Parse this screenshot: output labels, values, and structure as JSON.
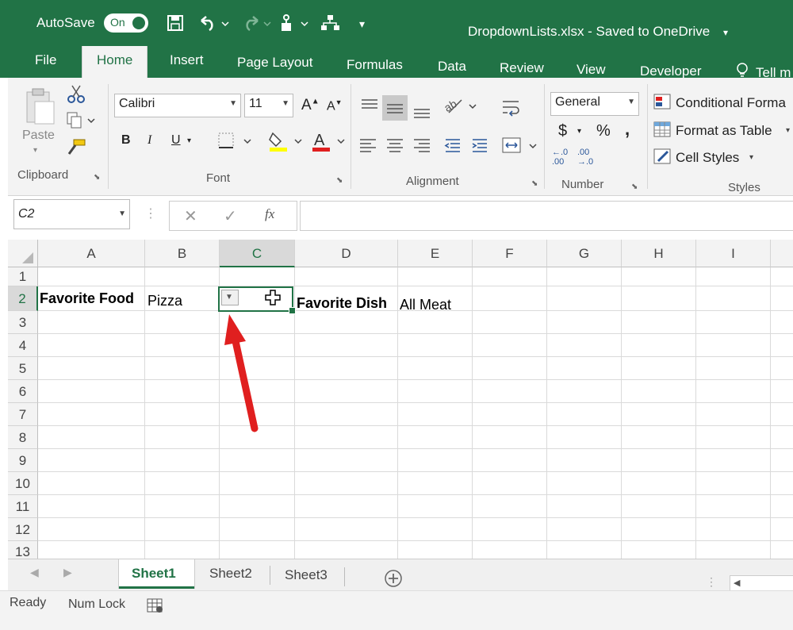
{
  "titlebar": {
    "autosave_label": "AutoSave",
    "autosave_state": "On",
    "document_title": "DropdownLists.xlsx - Saved to OneDrive"
  },
  "tabs": [
    "File",
    "Home",
    "Insert",
    "Page Layout",
    "Formulas",
    "Data",
    "Review",
    "View",
    "Developer",
    "Tell m"
  ],
  "ribbon": {
    "clipboard": {
      "paste": "Paste",
      "label": "Clipboard"
    },
    "font": {
      "font_name": "Calibri",
      "font_size": "11",
      "label": "Font",
      "bold": "B",
      "italic": "I",
      "underline": "U"
    },
    "alignment": {
      "label": "Alignment"
    },
    "number": {
      "format": "General",
      "currency": "$",
      "percent": "%",
      "comma": ",",
      "label": "Number",
      "inc_dec": "←.0 .00",
      "dec_dec": ".00 →.0"
    },
    "styles": {
      "conditional": "Conditional Forma",
      "format_table": "Format as Table",
      "cell_styles": "Cell Styles",
      "label": "Styles"
    }
  },
  "formula_bar": {
    "name_box": "C2",
    "fx": "fx",
    "content": ""
  },
  "grid": {
    "columns": [
      "A",
      "B",
      "C",
      "D",
      "E",
      "F",
      "G",
      "H",
      "I"
    ],
    "rows": [
      "1",
      "2",
      "3",
      "4",
      "5",
      "6",
      "7",
      "8",
      "9",
      "10",
      "11",
      "12",
      "13"
    ],
    "cells": {
      "A2": "Favorite Food",
      "B2": "Pizza",
      "D2": "Favorite Dish",
      "E2": "All Meat"
    }
  },
  "sheets": [
    "Sheet1",
    "Sheet2",
    "Sheet3"
  ],
  "status": {
    "ready": "Ready",
    "numlock": "Num Lock"
  },
  "colors": {
    "excel_green": "#217346",
    "arrow_red": "#e01f1f"
  }
}
